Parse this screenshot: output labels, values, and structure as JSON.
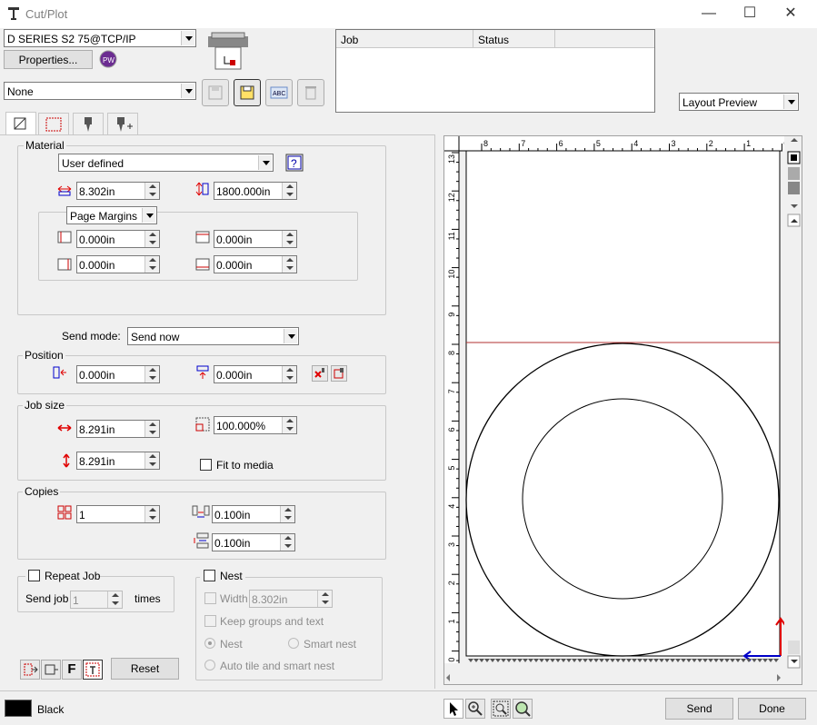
{
  "window": {
    "title": "Cut/Plot",
    "minimize": "—",
    "maximize": "☐",
    "close": "✕"
  },
  "device": {
    "value": "D SERIES S2 75@TCP/IP",
    "properties_label": "Properties..."
  },
  "preset": {
    "value": "None"
  },
  "job_table": {
    "columns": [
      "Job",
      "Status",
      ""
    ],
    "rows": []
  },
  "view_select": {
    "value": "Layout Preview"
  },
  "material": {
    "label": "Material",
    "value": "User defined",
    "width": "8.302in",
    "length": "1800.000in",
    "margins_select": "Page Margins",
    "margin_left": "0.000in",
    "margin_top": "0.000in",
    "margin_right": "0.000in",
    "margin_bottom": "0.000in"
  },
  "send_mode": {
    "label": "Send mode:",
    "value": "Send now"
  },
  "position": {
    "label": "Position",
    "x": "0.000in",
    "y": "0.000in"
  },
  "job_size": {
    "label": "Job size",
    "width": "8.291in",
    "height": "8.291in",
    "scale": "100.000%",
    "fit_label": "Fit to media",
    "fit_checked": false
  },
  "copies": {
    "label": "Copies",
    "count": "1",
    "h_spacing": "0.100in",
    "v_spacing": "0.100in"
  },
  "repeat_job": {
    "label": "Repeat Job",
    "send_label": "Send job",
    "count": "1",
    "times_label": "times"
  },
  "nest": {
    "label": "Nest",
    "width_label": "Width",
    "width_value": "8.302in",
    "keep_groups_label": "Keep groups and text",
    "nest_label": "Nest",
    "smart_nest_label": "Smart nest",
    "auto_label": "Auto tile and smart nest"
  },
  "bottom": {
    "reset_label": "Reset",
    "f_label": "F",
    "color_name": "Black",
    "send_label": "Send",
    "done_label": "Done"
  },
  "preview": {
    "h_ruler": [
      "8",
      "7",
      "6",
      "5",
      "4",
      "3",
      "2",
      "1",
      "0"
    ],
    "v_ruler": [
      "13",
      "12",
      "11",
      "10",
      "9",
      "8",
      "7",
      "6",
      "5",
      "4",
      "3",
      "2",
      "1",
      "0"
    ]
  },
  "colors": {
    "accent_red": "#e00000",
    "accent_blue": "#0000c8",
    "margin_line": "#b03030"
  }
}
